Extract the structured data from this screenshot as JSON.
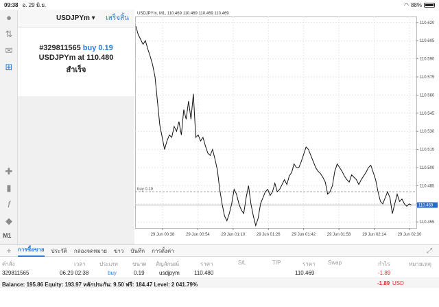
{
  "status": {
    "time": "09:38",
    "date": "อ. 29 มิ.ย.",
    "battery": "88%"
  },
  "panel": {
    "symbol": "USDJPYm",
    "done_label": "เสร็จสิ้น",
    "ticket_line": "#329811565",
    "side_volume": "buy 0.19",
    "symbol_at": "USDJPYm at",
    "price": "110.480",
    "result": "สำเร็จ"
  },
  "toolbar": {
    "timeframe": "M1"
  },
  "chart_data": {
    "type": "line",
    "title": "USDJPYm, M1, 110.469 110.469 110.469 110.469",
    "x_ticks": [
      "29 Jun 00:38",
      "29 Jun 00:54",
      "29 Jun 01:10",
      "29 Jun 01:26",
      "29 Jun 01:42",
      "29 Jun 01:58",
      "29 Jun 02:14",
      "29 Jun 02:30"
    ],
    "y_ticks": [
      "110.620",
      "110.605",
      "110.590",
      "110.575",
      "110.560",
      "110.545",
      "110.530",
      "110.515",
      "110.500",
      "110.485",
      "110.470",
      "110.455"
    ],
    "ylim": [
      110.45,
      110.625
    ],
    "order_line": {
      "label": "buy 0.19",
      "value": 110.48
    },
    "current_price": {
      "label": "110.469",
      "value": 110.469
    },
    "series": [
      {
        "values": [
          110.617,
          110.61,
          110.606,
          110.602,
          110.605,
          110.598,
          110.592,
          110.585,
          110.575,
          110.555,
          110.535,
          110.525,
          110.515,
          110.522,
          110.527,
          110.525,
          110.534,
          110.53,
          110.538,
          110.527,
          110.548,
          110.54,
          110.555,
          110.54,
          110.561,
          110.525,
          110.527,
          110.522,
          110.525,
          110.518,
          110.512,
          110.51,
          110.515,
          110.507,
          110.498,
          110.482,
          110.47,
          110.46,
          110.456,
          110.462,
          110.47,
          110.482,
          110.478,
          110.47,
          110.465,
          110.462,
          110.475,
          110.485,
          110.47,
          110.46,
          110.452,
          110.458,
          110.47,
          110.475,
          110.48,
          110.482,
          110.477,
          110.48,
          110.487,
          110.48,
          110.482,
          110.486,
          110.49,
          110.486,
          110.493,
          110.496,
          110.503,
          110.5,
          110.5,
          110.505,
          110.511,
          110.517,
          110.515,
          110.51,
          110.505,
          110.5,
          110.497,
          110.495,
          110.492,
          110.488,
          110.478,
          110.48,
          110.485,
          110.497,
          110.503,
          110.5,
          110.497,
          110.493,
          110.49,
          110.488,
          110.494,
          110.492,
          110.49,
          110.486,
          110.49,
          110.493,
          110.496,
          110.5,
          110.502,
          110.496,
          110.49,
          110.48,
          110.472,
          110.47,
          110.475,
          110.48,
          110.475,
          110.462,
          110.47,
          110.478,
          110.472,
          110.474,
          110.47,
          110.468,
          110.47,
          110.469
        ]
      }
    ]
  },
  "tabs": [
    "การซื้อขาย",
    "ประวัติ",
    "กล่องจดหมาย",
    "ข่าว",
    "บันทึก",
    "การตั้งค่า"
  ],
  "table": {
    "headers": [
      "คำสั่ง",
      "เวลา",
      "ประเภท",
      "ขนาด",
      "สัญลักษณ์",
      "ราคา",
      "S/L",
      "T/P",
      "ราคา",
      "Swap",
      "กำไร",
      "หมายเหตุ"
    ],
    "row": [
      "329811565",
      "06.29 02:38",
      "buy",
      "0.19",
      "usdjpym",
      "110.480",
      "",
      "",
      "110.469",
      "",
      "-1.89",
      ""
    ],
    "balance": "Balance: 195.86 Equity: 193.97 หลักประกัน: 9.50 ฟรี: 184.47 Level: 2 041.79%",
    "total_profit": "-1.89",
    "currency": "USD"
  }
}
